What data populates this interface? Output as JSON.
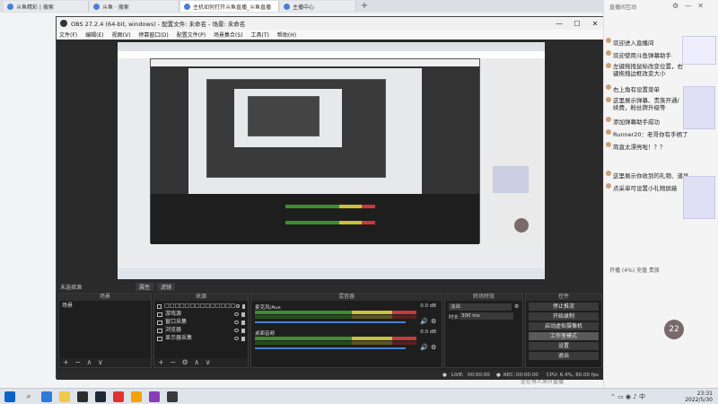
{
  "browser": {
    "tabs": [
      {
        "label": "斗鱼精彩 | 搜索",
        "active": false
      },
      {
        "label": "斗鱼 · 搜索",
        "active": false
      },
      {
        "label": "主机如何打开斗鱼直播_斗鱼直播",
        "active": true
      },
      {
        "label": "主播中心",
        "active": false
      }
    ],
    "new_tab": "+",
    "window_controls": [
      "—",
      "☐",
      "✕"
    ]
  },
  "page": {
    "bottom_text": "还在等人来开直播"
  },
  "obs": {
    "title": "OBS 27.2.4 (64-bit, windows) - 配置文件: 未命名 - 场景: 未命名",
    "menu": [
      "文件(F)",
      "编辑(E)",
      "视图(V)",
      "停靠窗口(D)",
      "配置文件(P)",
      "场景集合(S)",
      "工具(T)",
      "帮助(H)"
    ],
    "scene_toolbar": {
      "label": "未选择源",
      "props": "属性",
      "filters": "滤镜"
    },
    "panels": {
      "scenes": {
        "title": "场景",
        "items": [
          "场景"
        ]
      },
      "sources": {
        "title": "来源",
        "items": [
          "□□□□□□□□□□□□□□",
          "游戏源",
          "窗口采集",
          "浏览器",
          "显示器采集"
        ]
      },
      "mixer": {
        "title": "混音器",
        "tracks": [
          {
            "name": "麦克风/Aux",
            "db": "0.0 dB"
          },
          {
            "name": "桌面音频",
            "db": "0.0 dB"
          }
        ]
      },
      "transitions": {
        "title": "转场特效",
        "type": "淡出",
        "duration_label": "时长",
        "duration": "300 ms"
      },
      "controls": {
        "title": "控件",
        "buttons": [
          "停止推流",
          "开始录制",
          "启动虚拟摄像机",
          "工作室模式",
          "设置",
          "退出"
        ]
      }
    },
    "footer_buttons": [
      "+",
      "−",
      "∧",
      "∨"
    ],
    "status": {
      "live_label": "LIVE:",
      "live_time": "00:00:00",
      "rec_label": "REC:",
      "rec_time": "00:00:00",
      "cpu": "CPU: 6.4%, 60.00 fps"
    }
  },
  "chat": {
    "title": "直播间互动",
    "messages": [
      "欢迎进入直播间",
      "欢迎使用斗鱼弹幕助手",
      "左键拖拽鼠标改变位置，右键拖拽边框改变大小",
      "右上角有设置菜单",
      "这里展示弹幕、贵族开通/续费，粉丝牌升级等",
      "添加弹幕助手成功",
      "Runner20：老哥你有手柄了",
      "简直太漂亮啦！？？",
      "这里展示你收到的礼物、道具",
      "点采单可设置小礼物屏蔽"
    ],
    "footer": "开播 (4%) 充值 贵族",
    "badge": "22"
  },
  "taskbar": {
    "time": "23:31",
    "date": "2022/5/30"
  },
  "colors": {
    "obs_bg": "#2b2b2b",
    "meter_green": "#3c8f2c",
    "meter_yellow": "#c9c13a",
    "meter_red": "#c93a3a",
    "accent": "#4a7fd4"
  }
}
